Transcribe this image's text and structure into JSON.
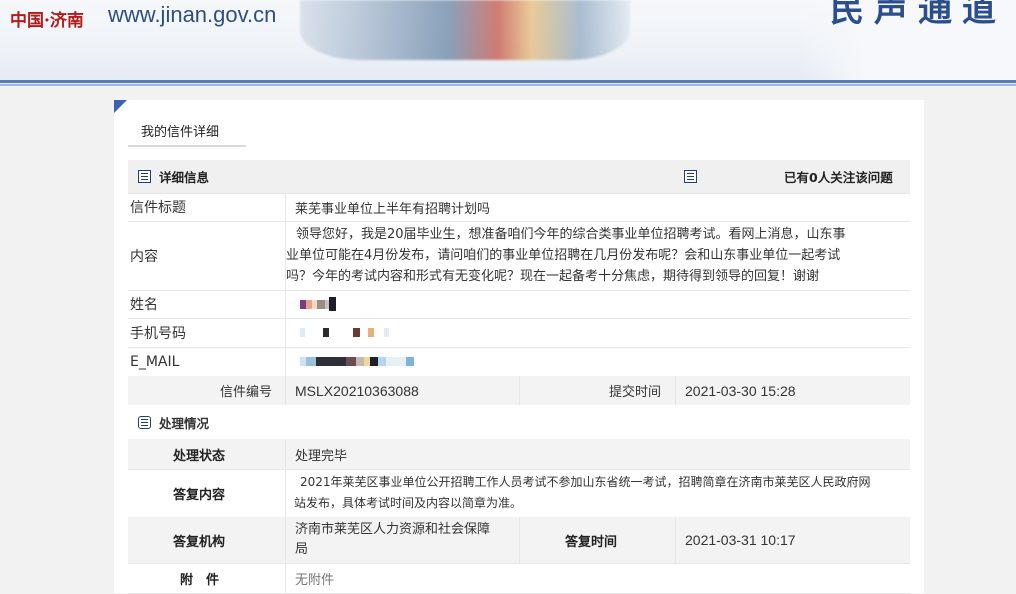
{
  "header": {
    "logo_cn": "中国·济南",
    "url": "www.jinan.gov.cn",
    "banner_text": "民声通道"
  },
  "page": {
    "title": "我的信件详细"
  },
  "detail": {
    "section_title": "详细信息",
    "follow_text": "已有0人关注该问题",
    "subject_label": "信件标题",
    "subject": "莱芜事业单位上半年有招聘计划吗",
    "content_label": "内容",
    "content_line1": "领导您好，我是20届毕业生，想准备咱们今年的综合类事业单位招聘考试。看网上消息，山东事",
    "content_line2": "业单位可能在4月份发布，请问咱们的事业单位招聘在几月份发布呢？会和山东事业单位一起考试",
    "content_line3": "吗？今年的考试内容和形式有无变化呢？现在一起备考十分焦虑，期待得到领导的回复！谢谢",
    "name_label": "姓名",
    "phone_label": "手机号码",
    "email_label": "E_MAIL",
    "letter_no_label": "信件编号",
    "letter_no": "MSLX20210363088",
    "submit_time_label": "提交时间",
    "submit_time": "2021-03-30 15:28"
  },
  "processing": {
    "section_title": "处理情况",
    "status_label": "处理状态",
    "status": "处理完毕",
    "reply_label": "答复内容",
    "reply_line1": "2021年莱芜区事业单位公开招聘工作人员考试不参加山东省统一考试，招聘简章在济南市莱芜区人民政府网",
    "reply_line2": "站发布，具体考试时间及内容以简章为准。",
    "org_label": "答复机构",
    "org_line1": "济南市莱芜区人力资源和社会保障",
    "org_line2": "局",
    "reply_time_label": "答复时间",
    "reply_time": "2021-03-31 10:17",
    "attach_label": "附　件",
    "attach": "无附件"
  },
  "icons": {
    "section": "list-icon"
  },
  "colors": {
    "accent": "#3a62ad",
    "header_bar": "#5a7bb4",
    "logo_red": "#b31a1a"
  }
}
